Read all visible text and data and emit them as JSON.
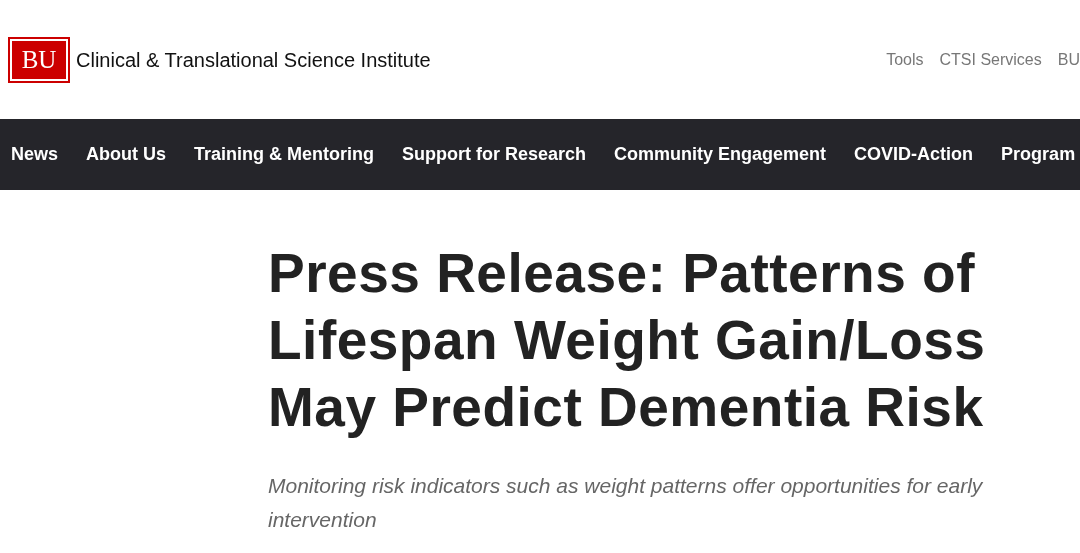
{
  "header": {
    "logo": "BU",
    "site_title": "Clinical & Translational Science Institute",
    "utility_links": [
      "Tools",
      "CTSI Services",
      "BU"
    ]
  },
  "nav": {
    "items": [
      "News",
      "About Us",
      "Training & Mentoring",
      "Support for Research",
      "Community Engagement",
      "COVID-Action",
      "Program"
    ]
  },
  "article": {
    "title": "Press Release: Patterns of Lifespan Weight Gain/Loss May Predict Dementia Risk",
    "subtitle": "Monitoring risk indicators such as weight patterns offer opportunities for early intervention"
  }
}
